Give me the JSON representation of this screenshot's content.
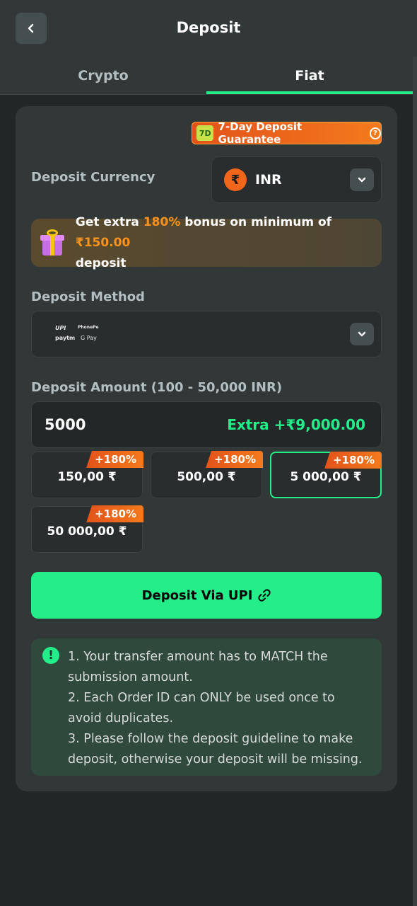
{
  "header": {
    "title": "Deposit",
    "back_icon": "chevron-left-icon"
  },
  "tabs": [
    {
      "label": "Crypto",
      "active": false
    },
    {
      "label": "Fiat",
      "active": true
    }
  ],
  "guarantee": {
    "label": "7-Day Deposit Guarantee",
    "icon_text": "7D"
  },
  "currency": {
    "label": "Deposit Currency",
    "symbol": "₹",
    "code": "INR"
  },
  "bonus": {
    "prefix": "Get extra ",
    "percent": "180%",
    "middle": " bonus on minimum of ",
    "minimum": "₹150.00",
    "suffix": "deposit"
  },
  "method": {
    "label": "Deposit Method",
    "logos": [
      "UPI",
      "PhonePe",
      "paytm",
      "G Pay"
    ]
  },
  "amount": {
    "label": "Deposit Amount (100 - 50,000 INR)",
    "value": "5000",
    "extra": "Extra +₹9,000.00"
  },
  "presets": [
    {
      "amount": "150,00 ₹",
      "badge": "+180%",
      "selected": false
    },
    {
      "amount": "500,00 ₹",
      "badge": "+180%",
      "selected": false
    },
    {
      "amount": "5 000,00 ₹",
      "badge": "+180%",
      "selected": true
    },
    {
      "amount": "50 000,00 ₹",
      "badge": "+180%",
      "selected": false
    }
  ],
  "deposit_button": {
    "label": "Deposit Via UPI"
  },
  "notice": {
    "lines": [
      "1. Your transfer amount has to MATCH the",
      "submission amount.",
      "2. Each Order ID can ONLY be used once to",
      "avoid duplicates.",
      "3. Please follow the deposit guideline to make",
      "deposit, otherwise your deposit will be missing."
    ]
  },
  "colors": {
    "accent": "#24ee89",
    "orange": "#f7931e",
    "background": "#232626",
    "panel": "#323738"
  }
}
